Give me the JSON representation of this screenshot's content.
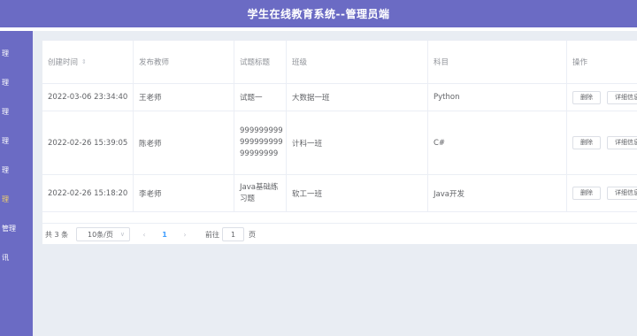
{
  "header": {
    "title": "学生在线教育系统--管理员端"
  },
  "sidebar": {
    "items": [
      {
        "label": "理",
        "active": false
      },
      {
        "label": "理",
        "active": false
      },
      {
        "label": "理",
        "active": false
      },
      {
        "label": "理",
        "active": false
      },
      {
        "label": "理",
        "active": false
      },
      {
        "label": "理",
        "active": true
      },
      {
        "label": "管理",
        "active": false
      },
      {
        "label": "讯",
        "active": false
      }
    ]
  },
  "table": {
    "columns": [
      "创建时间",
      "发布教师",
      "试题标题",
      "班级",
      "科目",
      "操作"
    ],
    "sort_icon": "sort-caret-icon",
    "rows": [
      {
        "created": "2022-03-06 23:34:40",
        "teacher": "王老师",
        "title": "试题一",
        "class": "大数据一班",
        "subject": "Python",
        "delete": "删除",
        "detail": "详细信息"
      },
      {
        "created": "2022-02-26 15:39:05",
        "teacher": "陈老师",
        "title": "99999999999999999999999999",
        "class": "计科一班",
        "subject": "C#",
        "delete": "删除",
        "detail": "详细信息"
      },
      {
        "created": "2022-02-26 15:18:20",
        "teacher": "李老师",
        "title": "Java基础练习题",
        "class": "软工一班",
        "subject": "Java开发",
        "delete": "删除",
        "detail": "详细信息"
      }
    ]
  },
  "pagination": {
    "total": "共 3 条",
    "page_size": "10条/页",
    "prev_icon": "chevron-left-icon",
    "next_icon": "chevron-right-icon",
    "current_page": "1",
    "goto_label": "前往",
    "goto_value": "1",
    "page_unit": "页"
  }
}
